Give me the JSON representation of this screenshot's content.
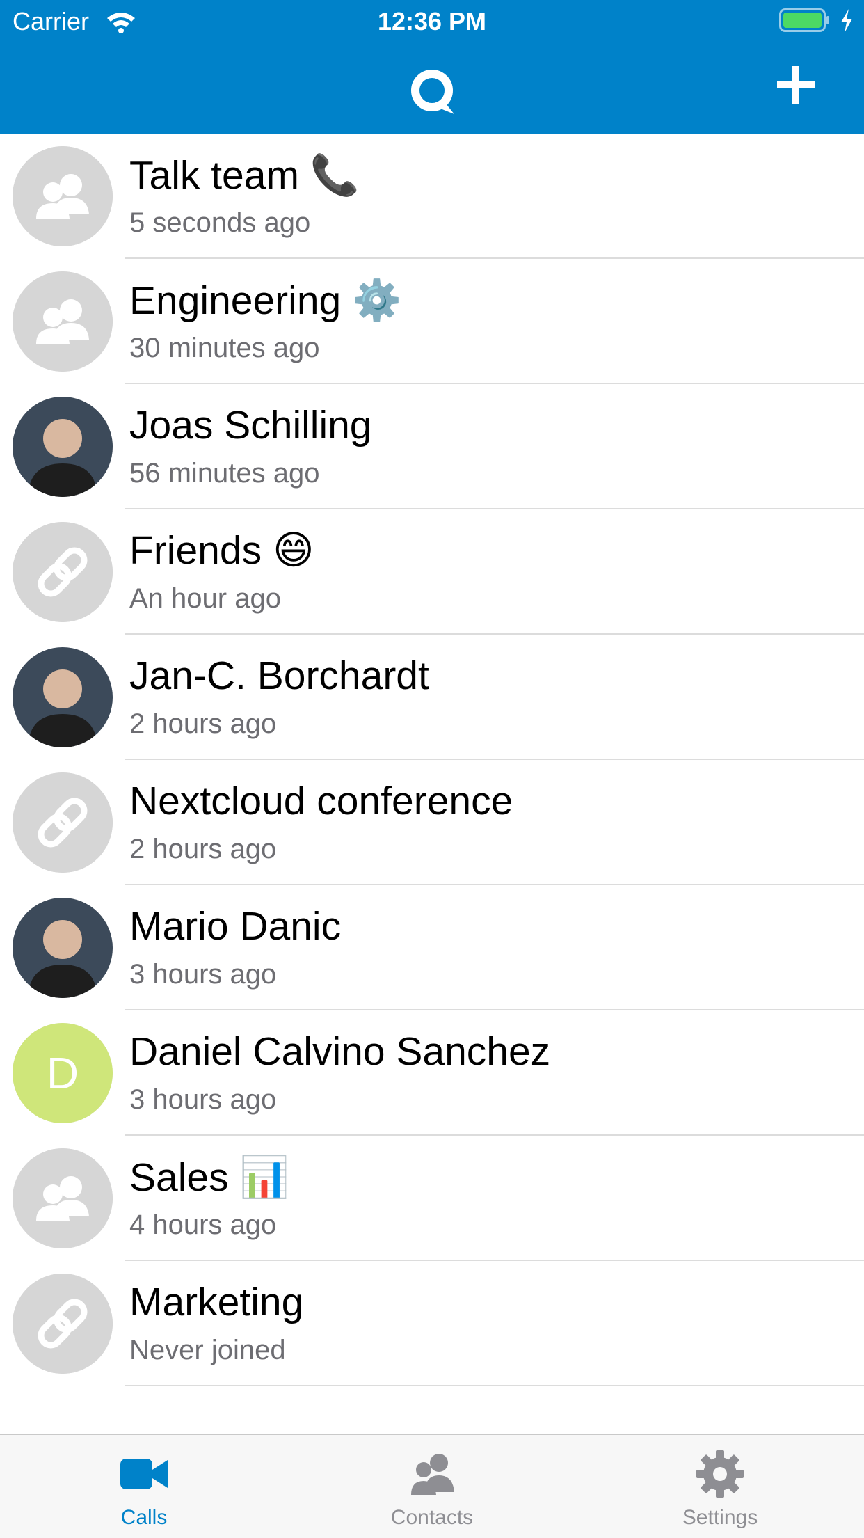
{
  "status_bar": {
    "carrier": "Carrier",
    "time": "12:36 PM"
  },
  "colors": {
    "brand": "#0082c9",
    "avatar_placeholder": "#d6d6d6",
    "avatar_letter_bg": "#cfe67a",
    "subtitle": "#6d6d72",
    "tab_inactive": "#8e8e93"
  },
  "conversations": [
    {
      "title": "Talk team",
      "emoji": "📞",
      "subtitle": "5 seconds ago",
      "avatar": "group-icon"
    },
    {
      "title": "Engineering",
      "emoji": "⚙️",
      "subtitle": "30 minutes ago",
      "avatar": "group-icon"
    },
    {
      "title": "Joas Schilling",
      "emoji": "",
      "subtitle": "56 minutes ago",
      "avatar": "photo"
    },
    {
      "title": "Friends",
      "emoji": "😄",
      "subtitle": "An hour ago",
      "avatar": "link-icon"
    },
    {
      "title": "Jan-C. Borchardt",
      "emoji": "",
      "subtitle": "2 hours ago",
      "avatar": "photo"
    },
    {
      "title": "Nextcloud conference",
      "emoji": "",
      "subtitle": "2 hours ago",
      "avatar": "link-icon"
    },
    {
      "title": "Mario Danic",
      "emoji": "",
      "subtitle": "3 hours ago",
      "avatar": "photo"
    },
    {
      "title": "Daniel Calvino Sanchez",
      "emoji": "",
      "subtitle": "3 hours ago",
      "avatar": "letter",
      "letter": "D"
    },
    {
      "title": "Sales",
      "emoji": "📊",
      "subtitle": "4 hours ago",
      "avatar": "group-icon"
    },
    {
      "title": "Marketing",
      "emoji": "",
      "subtitle": "Never joined",
      "avatar": "link-icon"
    }
  ],
  "tabbar": {
    "tabs": [
      {
        "label": "Calls",
        "icon": "video-camera-icon",
        "active": true
      },
      {
        "label": "Contacts",
        "icon": "contacts-icon",
        "active": false
      },
      {
        "label": "Settings",
        "icon": "gear-icon",
        "active": false
      }
    ]
  }
}
